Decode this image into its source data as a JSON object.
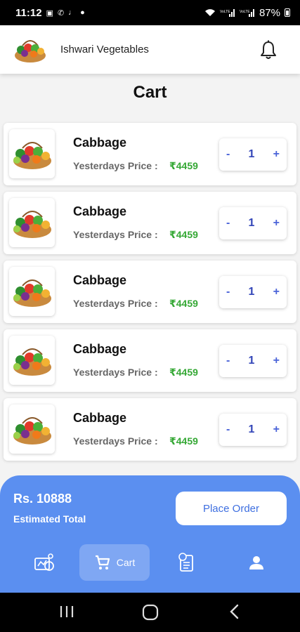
{
  "status_bar": {
    "time": "11:12",
    "battery": "87%",
    "left_icons": [
      "image-icon",
      "missed-call-icon",
      "music-icon",
      "dot-icon"
    ],
    "right_icons": [
      "wifi-icon",
      "signal-volte1-icon",
      "signal-volte2-icon",
      "battery-icon"
    ]
  },
  "app_bar": {
    "title": "Ishwari Vegetables",
    "logo_icon": "vegetable-basket-icon",
    "notification_icon": "bell-icon"
  },
  "page": {
    "title": "Cart"
  },
  "cart_items": [
    {
      "name": "Cabbage",
      "price_label": "Yesterdays Price :",
      "price": "₹4459",
      "quantity": "1",
      "minus": "-",
      "plus": "+"
    },
    {
      "name": "Cabbage",
      "price_label": "Yesterdays Price :",
      "price": "₹4459",
      "quantity": "1",
      "minus": "-",
      "plus": "+"
    },
    {
      "name": "Cabbage",
      "price_label": "Yesterdays Price :",
      "price": "₹4459",
      "quantity": "1",
      "minus": "-",
      "plus": "+"
    },
    {
      "name": "Cabbage",
      "price_label": "Yesterdays Price :",
      "price": "₹4459",
      "quantity": "1",
      "minus": "-",
      "plus": "+"
    },
    {
      "name": "Cabbage",
      "price_label": "Yesterdays Price :",
      "price": "₹4459",
      "quantity": "1",
      "minus": "-",
      "plus": "+"
    }
  ],
  "summary": {
    "total": "Rs. 10888",
    "total_label": "Estimated Total",
    "place_order_label": "Place Order"
  },
  "bottom_nav": {
    "items": [
      {
        "icon": "vegetables-icon"
      },
      {
        "icon": "cart-icon",
        "label": "Cart",
        "active": true
      },
      {
        "icon": "orders-icon"
      },
      {
        "icon": "profile-icon"
      }
    ]
  },
  "colors": {
    "accent": "#5b8ff0",
    "price_green": "#35a835",
    "stepper_blue": "#4a63d8"
  }
}
